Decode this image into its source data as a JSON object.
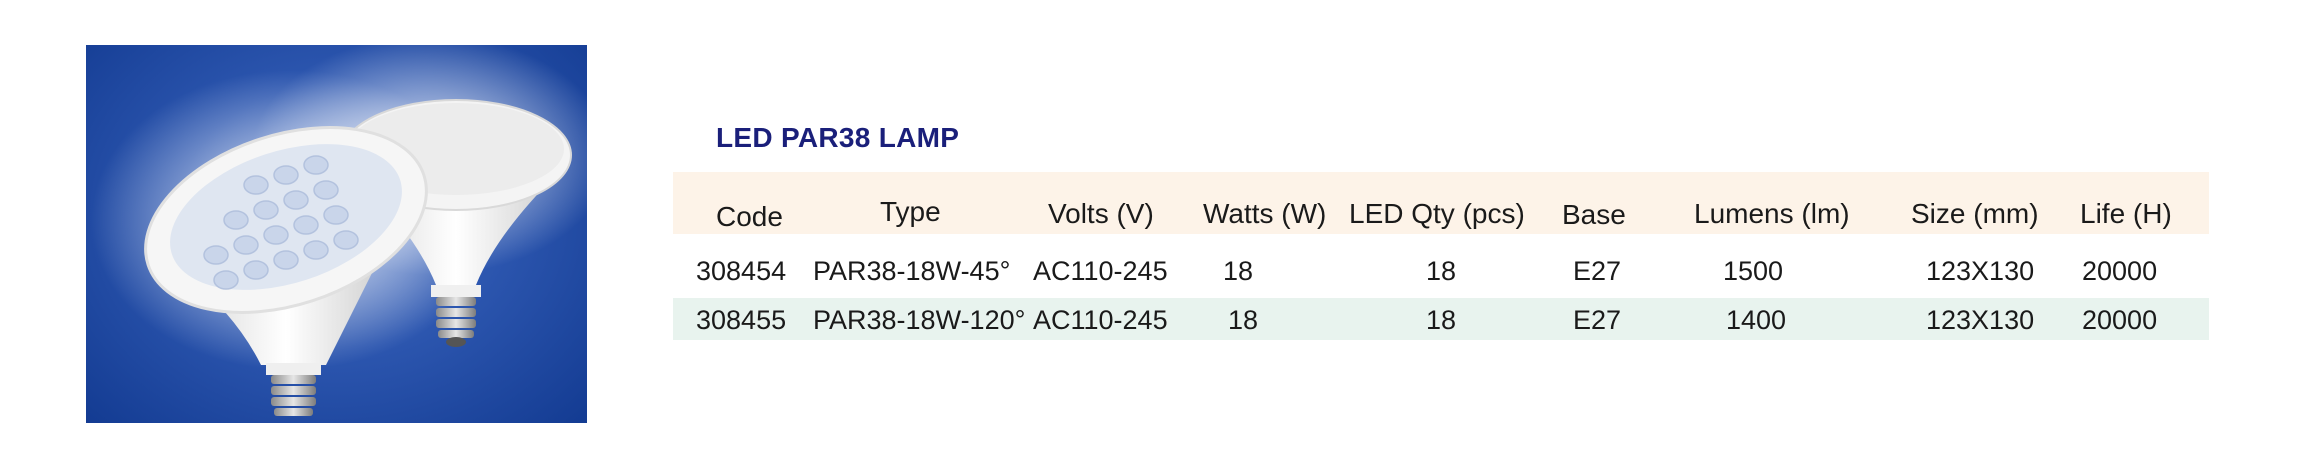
{
  "product": {
    "title": "LED PAR38 LAMP",
    "image_alt": "two LED PAR38 lamp bulbs on blue background"
  },
  "table": {
    "headers": [
      "Code",
      "Type",
      "Volts (V)",
      "Watts (W)",
      "LED Qty (pcs)",
      "Base",
      "Lumens (lm)",
      "Size (mm)",
      "Life (H)"
    ],
    "rows": [
      [
        "308454",
        "PAR38-18W-45°",
        "AC110-245",
        "18",
        "18",
        "E27",
        "1500",
        "123X130",
        "20000"
      ],
      [
        "308455",
        "PAR38-18W-120°",
        "AC110-245",
        "18",
        "18",
        "E27",
        "1400",
        "123X130",
        "20000"
      ]
    ]
  },
  "colors": {
    "title": "#1a1f7a",
    "header_band": "#fdf3e8",
    "row2_band": "#e8f3ee",
    "photo_bg": "#1d47a0"
  }
}
